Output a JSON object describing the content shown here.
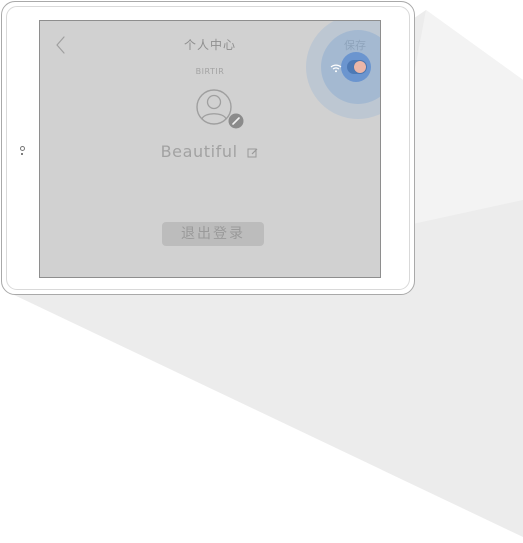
{
  "header": {
    "title": "个人中心",
    "save_label": "保存"
  },
  "status": {
    "text": "BIRTIR"
  },
  "profile": {
    "display_name": "Beautiful"
  },
  "actions": {
    "logout_label": "退出登录"
  },
  "controls": {
    "toggle_state": "on"
  },
  "icons": {
    "back": "chevron-left-icon",
    "avatar": "user-avatar-icon",
    "avatar_edit": "pencil-icon",
    "name_edit": "edit-icon",
    "wifi": "wifi-icon"
  },
  "colors": {
    "screen_background": "#d1d1d1",
    "text_muted": "#a2a2a2",
    "touch_highlight": "#4d79b5",
    "logout_button": "#bcbcbc"
  }
}
